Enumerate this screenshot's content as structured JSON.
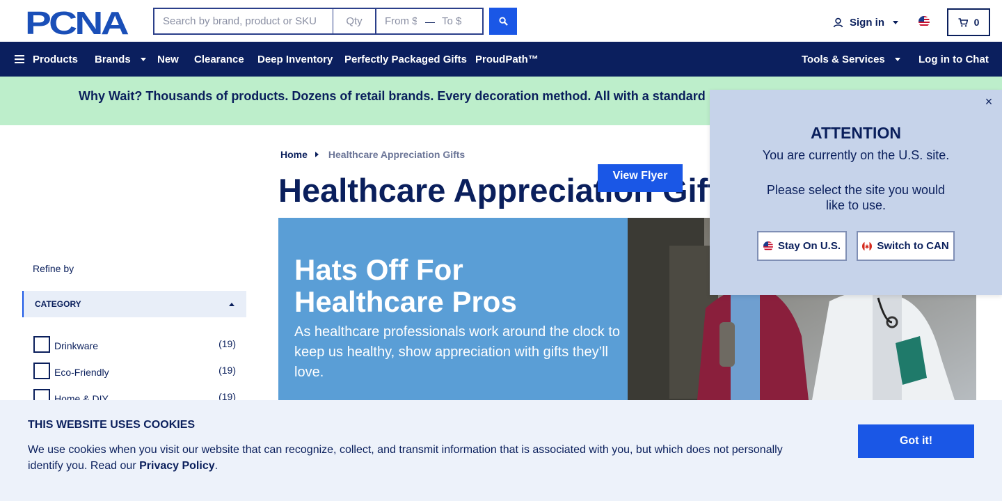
{
  "brand": {
    "logo_text": "PCNA",
    "accent": "#1a57e6",
    "navy": "#0b1f5e"
  },
  "search": {
    "placeholder": "Search by brand, product or SKU",
    "qty_placeholder": "Qty",
    "from_placeholder": "From $",
    "range_separator": "—",
    "to_placeholder": "To $",
    "button_icon": "search-icon"
  },
  "account": {
    "sign_in_label": "Sign in",
    "cart_count": "0",
    "region_flag": "us-flag-icon"
  },
  "nav": {
    "products": "Products",
    "brands": "Brands",
    "new": "New",
    "clearance": "Clearance",
    "deep_inventory": "Deep Inventory",
    "gifts": "Perfectly Packaged Gifts",
    "proudpath": "ProudPath™",
    "tools": "Tools & Services",
    "chat": "Log in to Chat"
  },
  "banner": {
    "text": "Why Wait? Thousands of products. Dozens of retail brands. Every decoration method. All with a standard"
  },
  "sidebar": {
    "refine_label": "Refine by",
    "category_heading": "CATEGORY",
    "filters": [
      {
        "label": "Drinkware",
        "count": "(19)"
      },
      {
        "label": "Eco-Friendly",
        "count": "(19)"
      },
      {
        "label": "Home & DIY",
        "count": "(19)"
      }
    ]
  },
  "breadcrumb": {
    "home": "Home",
    "current": "Healthcare Appreciation Gifts"
  },
  "page_title": "Healthcare Appreciation Gifts",
  "hero": {
    "headline": "Hats Off For Healthcare Pros",
    "subtext": "As healthcare professionals work around the clock to keep us healthy, show appreciation with gifts they’ll love.",
    "cta": "View Flyer"
  },
  "modal": {
    "title": "ATTENTION",
    "line1": "You are currently on the U.S. site.",
    "line2": "Please select the site you would like to use.",
    "stay_label": "Stay On U.S.",
    "switch_label": "Switch to CAN",
    "close_symbol": "×"
  },
  "cookie": {
    "title": "THIS WEBSITE USES COOKIES",
    "text_before": "We use cookies when you visit our website that can recognize, collect, and transmit information that is associated with you, but which does not personally identify you. Read our ",
    "link": "Privacy Policy",
    "text_after": ".",
    "button": "Got it!"
  }
}
